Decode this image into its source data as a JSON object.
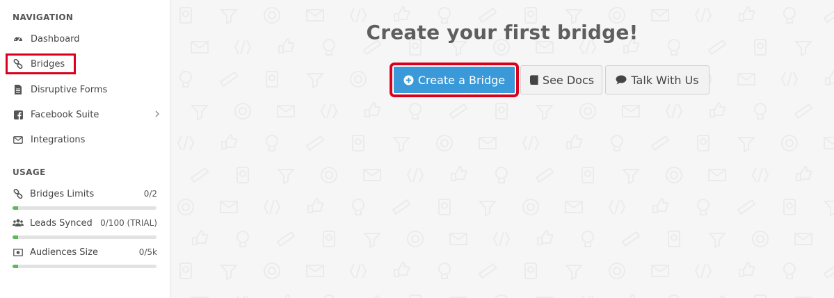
{
  "sidebar": {
    "navigation_title": "NAVIGATION",
    "items": [
      {
        "label": "Dashboard",
        "icon": "dashboard-icon"
      },
      {
        "label": "Bridges",
        "icon": "link-icon",
        "active": true
      },
      {
        "label": "Disruptive Forms",
        "icon": "document-icon"
      },
      {
        "label": "Facebook Suite",
        "icon": "facebook-icon",
        "has_submenu": true
      },
      {
        "label": "Integrations",
        "icon": "envelope-icon"
      }
    ],
    "usage_title": "USAGE",
    "usage": [
      {
        "label": "Bridges Limits",
        "value": "0/2",
        "icon": "link-icon",
        "fill_fraction": 0.04
      },
      {
        "label": "Leads Synced",
        "value": "0/100 (TRIAL)",
        "icon": "users-icon",
        "fill_fraction": 0.04
      },
      {
        "label": "Audiences Size",
        "value": "0/5k",
        "icon": "money-icon",
        "fill_fraction": 0.04
      }
    ]
  },
  "main": {
    "heading": "Create your first bridge!",
    "buttons": {
      "create": "Create a Bridge",
      "docs": "See Docs",
      "talk": "Talk With Us"
    }
  },
  "colors": {
    "primary": "#3a9ad9",
    "highlight": "#d9001b",
    "progress": "#5cb85c"
  }
}
